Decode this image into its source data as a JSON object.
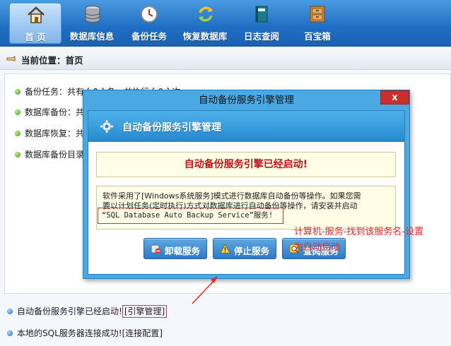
{
  "nav": {
    "items": [
      {
        "label": "首 页",
        "icon": "home-icon",
        "active": true
      },
      {
        "label": "数据库信息",
        "icon": "database-icon"
      },
      {
        "label": "备份任务",
        "icon": "clock-icon"
      },
      {
        "label": "恢复数据库",
        "icon": "refresh-icon"
      },
      {
        "label": "日志查阅",
        "icon": "book-icon"
      },
      {
        "label": "百宝箱",
        "icon": "cabinet-icon"
      }
    ]
  },
  "breadcrumb": {
    "text": "当前位置：首页",
    "icon": "hand-pointer-icon"
  },
  "main": {
    "rows": [
      "备份任务：共有 [ 0 ] 条，共执行 [ 0 ] 次",
      "数据库备份：共",
      "数据库恢复：共",
      "数据库备份目录"
    ]
  },
  "status": {
    "engine_text": "自动备份服务引擎已经启动!",
    "engine_link": "[引擎管理]",
    "sql_text": "本地的SQL服务器连接成功!",
    "sql_link": "[连接配置]"
  },
  "dialog": {
    "title": "自动备份服务引擎管理",
    "close": "x",
    "header": "自动备份服务引擎管理",
    "header_icon": "gear-icon",
    "notice": "自动备份服务引擎已经启动!",
    "desc_line1": "软件采用了[Windows系统服务]模式进行数据库自动备份等操作。如果您需",
    "desc_line2": "要以计划任务(定时执行)方式对数据库进行自动备份等操作，请安装并启动",
    "service_name": "“SQL Database Auto Backup Service”服务!",
    "buttons": [
      {
        "label": "卸载服务",
        "icon": "uninstall-icon"
      },
      {
        "label": "停止服务",
        "icon": "warning-icon"
      },
      {
        "label": "查阅服务",
        "icon": "view-icon"
      }
    ]
  },
  "annotation": {
    "line1": "计算机-服务-找到该服务名-设置",
    "line2": "为自动启动"
  }
}
